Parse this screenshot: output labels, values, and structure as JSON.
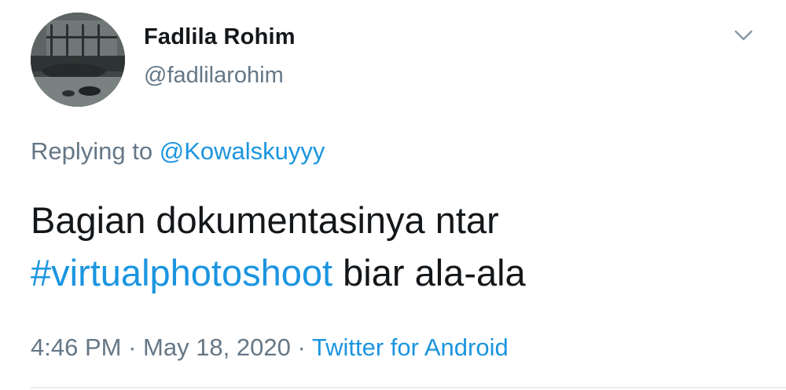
{
  "tweet": {
    "author": {
      "display_name": "Fadlila Rohim",
      "handle": "@fadlilarohim",
      "avatar_icon": "profile-photo"
    },
    "menu_icon": "chevron-down-icon",
    "reply": {
      "prefix": "Replying to ",
      "mention": "@Kowalskuyyy"
    },
    "text": {
      "line1": "Bagian dokumentasinya ntar",
      "hashtag": "#virtualphotoshoot",
      "after_hashtag": " biar ala-ala"
    },
    "meta": {
      "time": "4:46 PM",
      "separator1": " · ",
      "date": "May 18, 2020",
      "separator2": " · ",
      "source": "Twitter for Android"
    }
  },
  "colors": {
    "text_primary": "#14171a",
    "text_secondary": "#657786",
    "link": "#1b95e0",
    "divider": "#e6ecf0"
  }
}
